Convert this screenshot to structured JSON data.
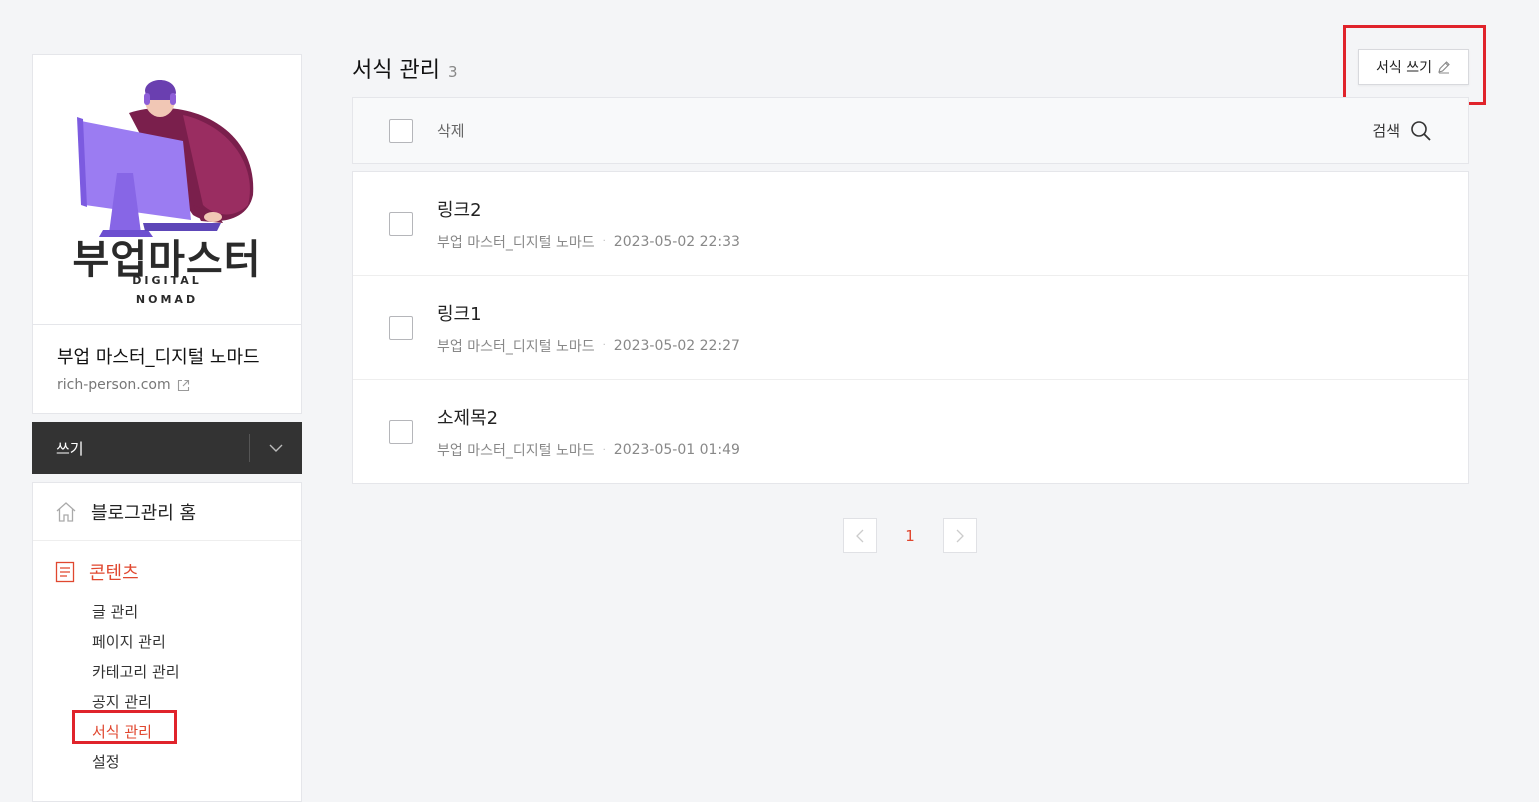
{
  "sidebar": {
    "logo": {
      "title": "부업마스터",
      "line1": "DIGITAL",
      "line2": "NOMAD"
    },
    "blog_name": "부업 마스터_디지털 노마드",
    "blog_url": "rich-person.com",
    "write_label": "쓰기",
    "home_label": "블로그관리 홈",
    "content_label": "콘텐츠",
    "submenu": [
      {
        "label": "글 관리"
      },
      {
        "label": "페이지 관리"
      },
      {
        "label": "카테고리 관리"
      },
      {
        "label": "공지 관리"
      },
      {
        "label": "서식 관리"
      },
      {
        "label": "설정"
      }
    ]
  },
  "header": {
    "title": "서식 관리",
    "count": "3",
    "compose_label": "서식 쓰기"
  },
  "toolbar": {
    "delete_label": "삭제",
    "search_label": "검색"
  },
  "posts": [
    {
      "title": "링크2",
      "author": "부업 마스터_디지털 노마드",
      "date": "2023-05-02 22:33"
    },
    {
      "title": "링크1",
      "author": "부업 마스터_디지털 노마드",
      "date": "2023-05-02 22:27"
    },
    {
      "title": "소제목2",
      "author": "부업 마스터_디지털 노마드",
      "date": "2023-05-01 01:49"
    }
  ],
  "pagination": {
    "current": "1"
  },
  "colors": {
    "accent": "#e0472f",
    "highlight": "#e0232b",
    "dark": "#333333"
  }
}
